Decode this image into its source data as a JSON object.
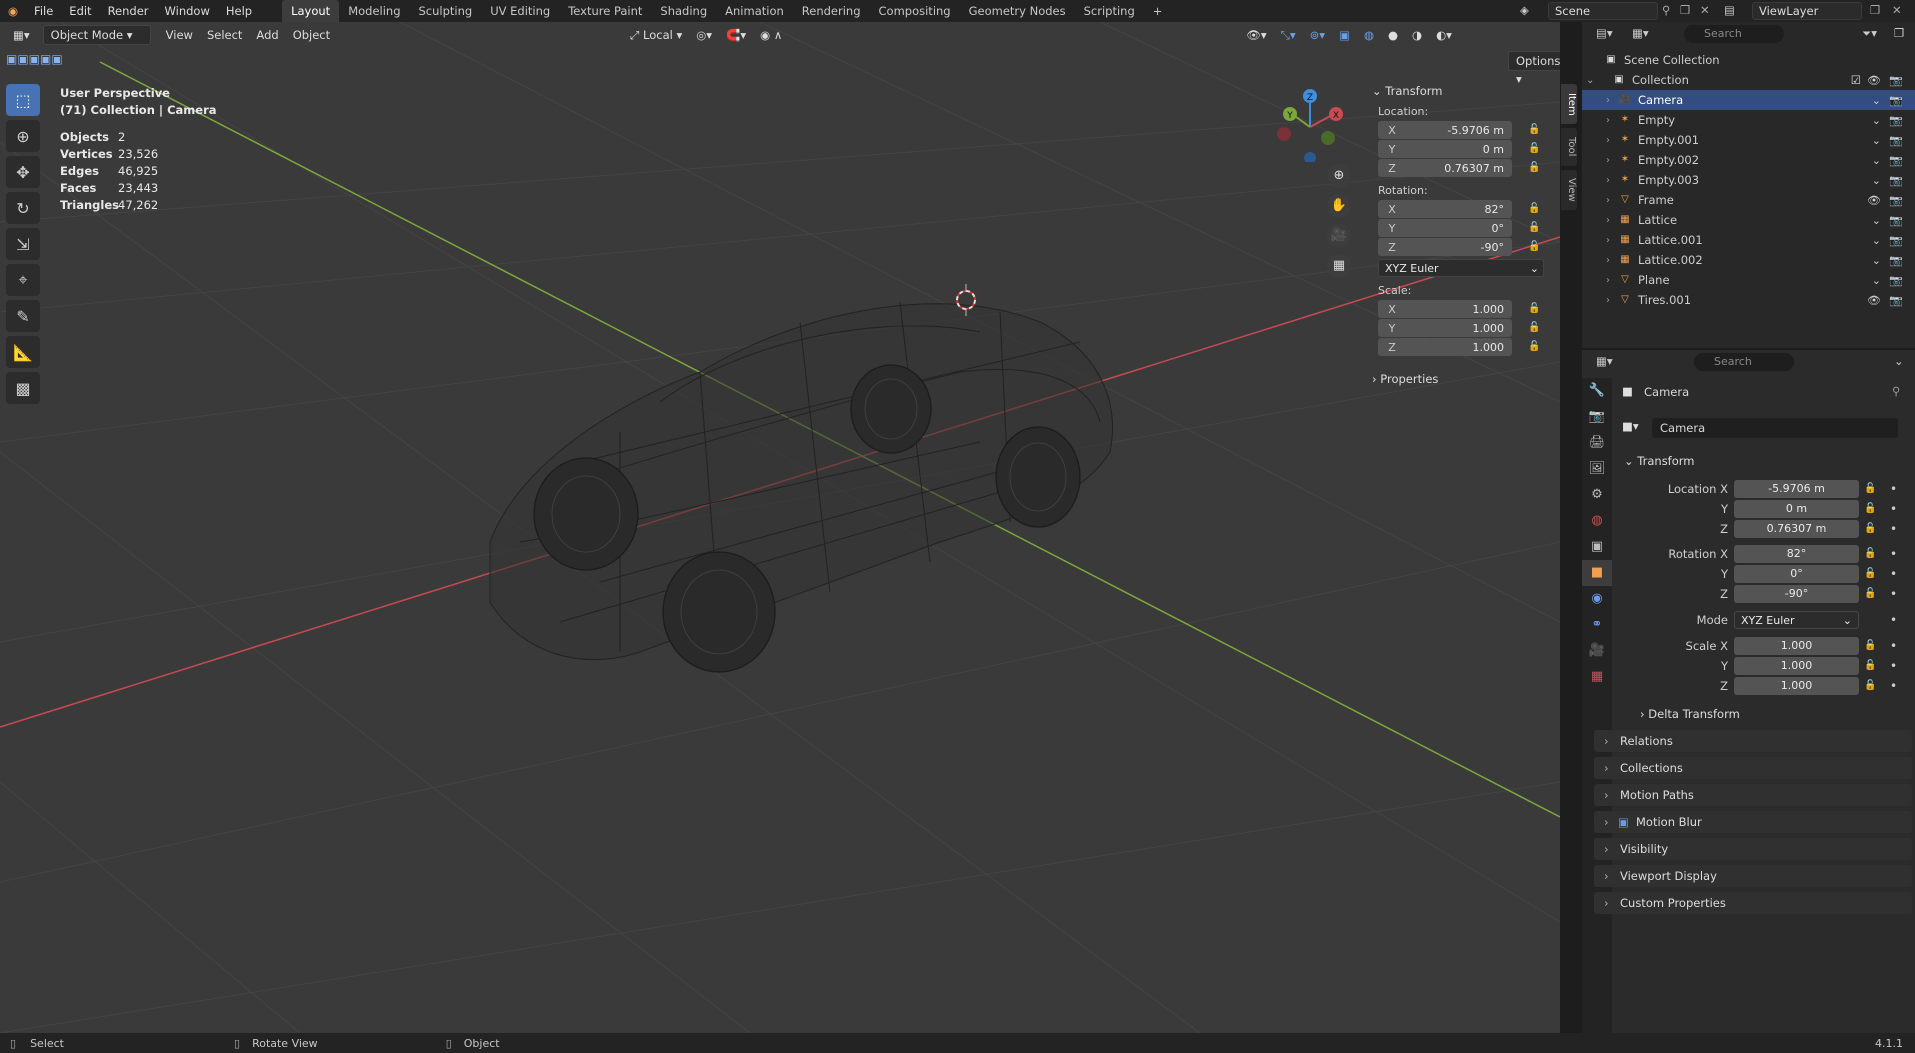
{
  "menu": [
    "File",
    "Edit",
    "Render",
    "Window",
    "Help"
  ],
  "workspaces": [
    "Layout",
    "Modeling",
    "Sculpting",
    "UV Editing",
    "Texture Paint",
    "Shading",
    "Animation",
    "Rendering",
    "Compositing",
    "Geometry Nodes",
    "Scripting"
  ],
  "active_workspace": "Layout",
  "scene": "Scene",
  "view_layer": "ViewLayer",
  "viewport": {
    "mode": "Object Mode",
    "menus": [
      "View",
      "Select",
      "Add",
      "Object"
    ],
    "orientation": "Local",
    "options": "Options",
    "overlay_title": "User Perspective",
    "overlay_sub": "(71) Collection | Camera",
    "stats": [
      {
        "k": "Objects",
        "v": "2"
      },
      {
        "k": "Vertices",
        "v": "23,526"
      },
      {
        "k": "Edges",
        "v": "46,925"
      },
      {
        "k": "Faces",
        "v": "23,443"
      },
      {
        "k": "Triangles",
        "v": "47,262"
      }
    ],
    "gizmo": {
      "x": "X",
      "y": "Y",
      "z": "Z"
    },
    "side_tabs": [
      "Item",
      "Tool",
      "View"
    ]
  },
  "npanel": {
    "title": "Transform",
    "location_label": "Location:",
    "location": [
      {
        "ax": "X",
        "v": "-5.9706 m"
      },
      {
        "ax": "Y",
        "v": "0 m"
      },
      {
        "ax": "Z",
        "v": "0.76307 m"
      }
    ],
    "rotation_label": "Rotation:",
    "rotation": [
      {
        "ax": "X",
        "v": "82°"
      },
      {
        "ax": "Y",
        "v": "0°"
      },
      {
        "ax": "Z",
        "v": "-90°"
      }
    ],
    "rotation_mode": "XYZ Euler",
    "scale_label": "Scale:",
    "scale": [
      {
        "ax": "X",
        "v": "1.000"
      },
      {
        "ax": "Y",
        "v": "1.000"
      },
      {
        "ax": "Z",
        "v": "1.000"
      }
    ],
    "properties": "Properties"
  },
  "outliner": {
    "search_placeholder": "Search",
    "root": "Scene Collection",
    "collection": "Collection",
    "items": [
      {
        "name": "Camera",
        "color": "#f0a050",
        "sel": true
      },
      {
        "name": "Empty",
        "color": "#f0a050",
        "sel": false
      },
      {
        "name": "Empty.001",
        "color": "#f0a050",
        "sel": false
      },
      {
        "name": "Empty.002",
        "color": "#f0a050",
        "sel": false
      },
      {
        "name": "Empty.003",
        "color": "#f0a050",
        "sel": false
      },
      {
        "name": "Frame",
        "color": "#f0a050",
        "sel": false
      },
      {
        "name": "Lattice",
        "color": "#f0a050",
        "sel": false
      },
      {
        "name": "Lattice.001",
        "color": "#f0a050",
        "sel": false
      },
      {
        "name": "Lattice.002",
        "color": "#f0a050",
        "sel": false
      },
      {
        "name": "Plane",
        "color": "#f0a050",
        "sel": false
      },
      {
        "name": "Tires.001",
        "color": "#f0a050",
        "sel": false
      }
    ]
  },
  "properties": {
    "search_placeholder": "Search",
    "object_name": "Camera",
    "datablock": "Camera",
    "transform": "Transform",
    "loc_labels": [
      "Location X",
      "Y",
      "Z"
    ],
    "location": [
      "-5.9706 m",
      "0 m",
      "0.76307 m"
    ],
    "rot_labels": [
      "Rotation X",
      "Y",
      "Z"
    ],
    "rotation": [
      "82°",
      "0°",
      "-90°"
    ],
    "mode_label": "Mode",
    "mode": "XYZ Euler",
    "scale_labels": [
      "Scale X",
      "Y",
      "Z"
    ],
    "scale": [
      "1.000",
      "1.000",
      "1.000"
    ],
    "delta": "Delta Transform",
    "sections": [
      "Relations",
      "Collections",
      "Motion Paths",
      "Motion Blur",
      "Visibility",
      "Viewport Display",
      "Custom Properties"
    ]
  },
  "status": {
    "select": "Select",
    "rotate": "Rotate View",
    "object": "Object",
    "version": "4.1.1"
  },
  "colors": {
    "accent": "#4772b3",
    "x_axis": "#c84a52",
    "y_axis": "#7aa83a",
    "z_axis": "#3d8fe0"
  }
}
